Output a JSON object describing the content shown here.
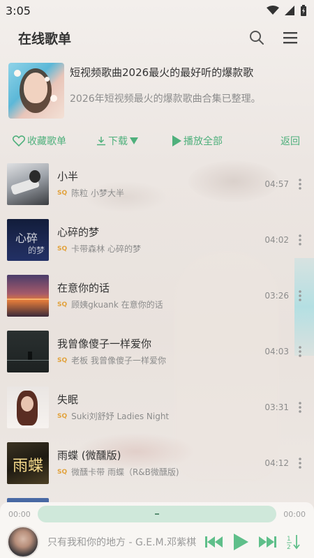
{
  "status_bar": {
    "time": "3:05"
  },
  "app_bar": {
    "title": "在线歌单"
  },
  "playlist": {
    "title": "短视频歌曲2026最火的最好听的爆款歌",
    "description": "2026年短视频最火的爆款歌曲合集已整理。"
  },
  "actions": {
    "favorite_label": "收藏歌单",
    "download_label": "下载",
    "play_all_label": "播放全部",
    "back_label": "返回"
  },
  "quality_badge": "SQ",
  "songs": [
    {
      "title": "小半",
      "artist": "陈粒 小梦大半",
      "duration": "04:57"
    },
    {
      "title": "心碎的梦",
      "artist": "卡带森林 心碎的梦",
      "duration": "04:02"
    },
    {
      "title": "在意你的话",
      "artist": "顾姨gkuank 在意你的话",
      "duration": "03:26"
    },
    {
      "title": "我曾像傻子一样爱你",
      "artist": "老板 我曾像傻子一样爱你",
      "duration": "04:03"
    },
    {
      "title": "失眠",
      "artist": "Suki刘舒妤 Ladies Night",
      "duration": "03:31"
    },
    {
      "title": "雨蝶 (微醺版)",
      "artist": "微醺卡带 雨蝶（R&B微醺版)",
      "duration": "04:12"
    }
  ],
  "player": {
    "current_time": "00:00",
    "total_time": "00:00",
    "now_playing": "只有我和你的地方 - G.E.M.邓紫棋",
    "progress": 0.0
  },
  "colors": {
    "accent": "#4fb07c",
    "badge": "#e2a23c"
  }
}
